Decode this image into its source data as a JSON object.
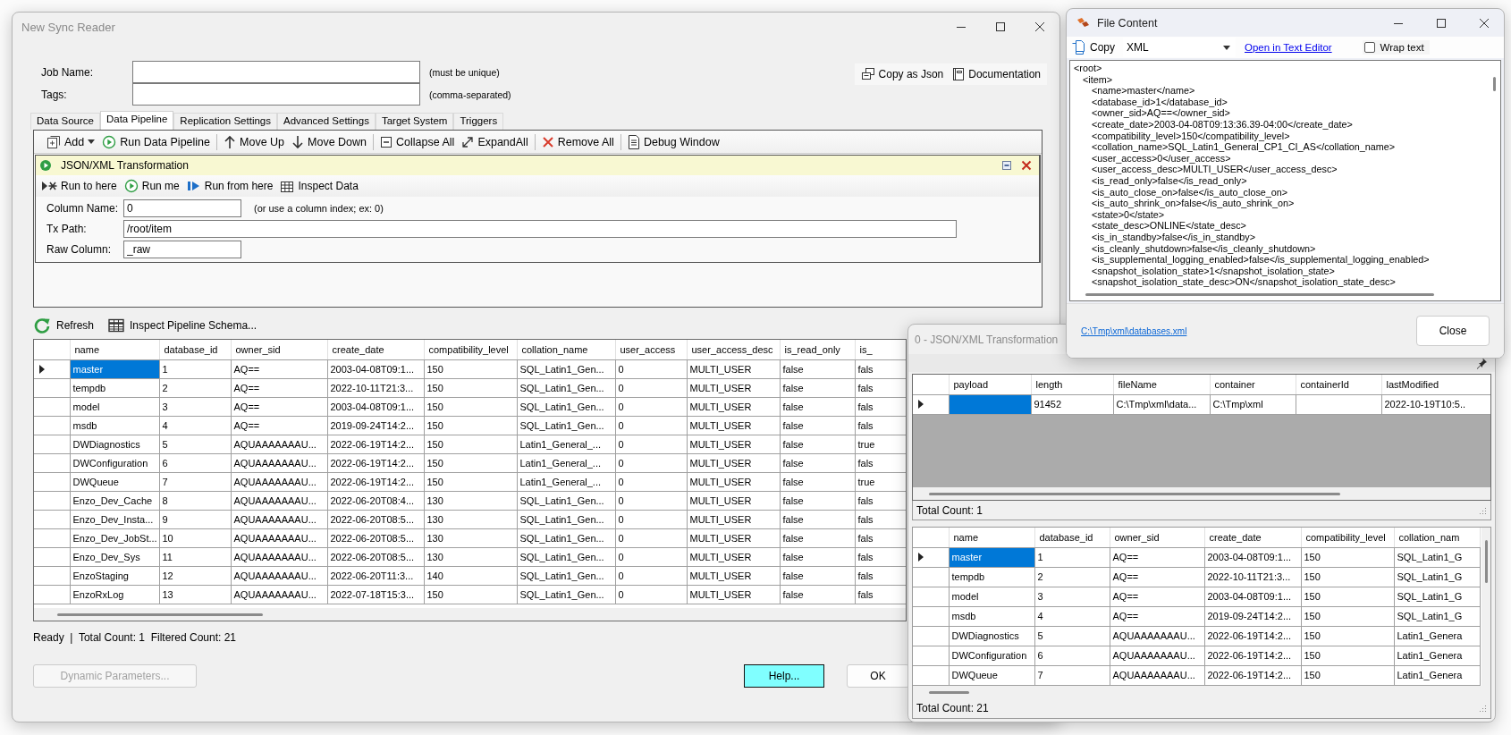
{
  "main_window": {
    "title": "New Sync Reader",
    "fields": [
      {
        "label": "Job Name:",
        "hint": "(must be unique)"
      },
      {
        "label": "Tags:",
        "hint": "(comma-separated)"
      }
    ],
    "header_buttons": [
      "Copy as Json",
      "Documentation"
    ],
    "tabs": [
      {
        "label": "Data Source",
        "selected": false
      },
      {
        "label": "Data Pipeline",
        "selected": true
      },
      {
        "label": "Replication Settings",
        "selected": false
      },
      {
        "label": "Advanced Settings",
        "selected": false
      },
      {
        "label": "Target System",
        "selected": false
      },
      {
        "label": "Triggers",
        "selected": false
      }
    ],
    "toolbar": [
      [
        {
          "label": "Add",
          "kind": "dropdown"
        },
        {
          "label": "Run Data Pipeline",
          "kind": "button"
        }
      ],
      [
        {
          "label": "Move Up",
          "kind": "button"
        },
        {
          "label": "Move Down",
          "kind": "button"
        }
      ],
      [
        {
          "label": "Collapse All",
          "kind": "button"
        },
        {
          "label": "ExpandAll",
          "kind": "button"
        }
      ],
      [
        {
          "label": "Remove All",
          "kind": "button"
        }
      ],
      [
        {
          "label": "Debug Window",
          "kind": "button"
        }
      ]
    ],
    "step": {
      "title": "JSON/XML Transformation",
      "actions": [
        "Run to here",
        "Run me",
        "Run from here",
        "Inspect Data"
      ],
      "fields": [
        {
          "label": "Column Name:",
          "value": "0",
          "hint": "(or use a column index; ex: 0)",
          "kind": "short"
        },
        {
          "label": "Tx Path:",
          "value": "/root/item",
          "kind": "wide"
        },
        {
          "label": "Raw Column:",
          "value": "_raw",
          "kind": "short"
        }
      ]
    },
    "grid_toolbar": [
      "Refresh",
      "Inspect Pipeline Schema..."
    ],
    "grid": {
      "columns": [
        "name",
        "database_id",
        "owner_sid",
        "create_date",
        "compatibility_level",
        "collation_name",
        "user_access",
        "user_access_desc",
        "is_read_only",
        "is_"
      ],
      "rows": [
        {
          "selected": true,
          "cells": [
            "master",
            "1",
            "AQ==",
            "2003-04-08T09:1...",
            "150",
            "SQL_Latin1_Gen...",
            "0",
            "MULTI_USER",
            "false",
            "fals"
          ]
        },
        {
          "selected": false,
          "cells": [
            "tempdb",
            "2",
            "AQ==",
            "2022-10-11T21:3...",
            "150",
            "SQL_Latin1_Gen...",
            "0",
            "MULTI_USER",
            "false",
            "fals"
          ]
        },
        {
          "selected": false,
          "cells": [
            "model",
            "3",
            "AQ==",
            "2003-04-08T09:1...",
            "150",
            "SQL_Latin1_Gen...",
            "0",
            "MULTI_USER",
            "false",
            "fals"
          ]
        },
        {
          "selected": false,
          "cells": [
            "msdb",
            "4",
            "AQ==",
            "2019-09-24T14:2...",
            "150",
            "SQL_Latin1_Gen...",
            "0",
            "MULTI_USER",
            "false",
            "fals"
          ]
        },
        {
          "selected": false,
          "cells": [
            "DWDiagnostics",
            "5",
            "AQUAAAAAAAU...",
            "2022-06-19T14:2...",
            "150",
            "Latin1_General_...",
            "0",
            "MULTI_USER",
            "false",
            "true"
          ]
        },
        {
          "selected": false,
          "cells": [
            "DWConfiguration",
            "6",
            "AQUAAAAAAAU...",
            "2022-06-19T14:2...",
            "150",
            "Latin1_General_...",
            "0",
            "MULTI_USER",
            "false",
            "fals"
          ]
        },
        {
          "selected": false,
          "cells": [
            "DWQueue",
            "7",
            "AQUAAAAAAAU...",
            "2022-06-19T14:2...",
            "150",
            "Latin1_General_...",
            "0",
            "MULTI_USER",
            "false",
            "true"
          ]
        },
        {
          "selected": false,
          "cells": [
            "Enzo_Dev_Cache",
            "8",
            "AQUAAAAAAAU...",
            "2022-06-20T08:4...",
            "130",
            "SQL_Latin1_Gen...",
            "0",
            "MULTI_USER",
            "false",
            "fals"
          ]
        },
        {
          "selected": false,
          "cells": [
            "Enzo_Dev_Insta...",
            "9",
            "AQUAAAAAAAU...",
            "2022-06-20T08:5...",
            "130",
            "SQL_Latin1_Gen...",
            "0",
            "MULTI_USER",
            "false",
            "fals"
          ]
        },
        {
          "selected": false,
          "cells": [
            "Enzo_Dev_JobSt...",
            "10",
            "AQUAAAAAAAU...",
            "2022-06-20T08:5...",
            "130",
            "SQL_Latin1_Gen...",
            "0",
            "MULTI_USER",
            "false",
            "fals"
          ]
        },
        {
          "selected": false,
          "cells": [
            "Enzo_Dev_Sys",
            "11",
            "AQUAAAAAAAU...",
            "2022-06-20T08:5...",
            "130",
            "SQL_Latin1_Gen...",
            "0",
            "MULTI_USER",
            "false",
            "fals"
          ]
        },
        {
          "selected": false,
          "cells": [
            "EnzoStaging",
            "12",
            "AQUAAAAAAAU...",
            "2022-06-20T11:3...",
            "140",
            "SQL_Latin1_Gen...",
            "0",
            "MULTI_USER",
            "false",
            "fals"
          ]
        },
        {
          "selected": false,
          "cells": [
            "EnzoRxLog",
            "13",
            "AQUAAAAAAAU...",
            "2022-07-18T15:3...",
            "150",
            "SQL_Latin1_Gen...",
            "0",
            "MULTI_USER",
            "false",
            "fals"
          ]
        }
      ]
    },
    "status_bar": "Ready  |  Total Count: 1  Filtered Count: 21",
    "buttons": [
      {
        "label": "Dynamic Parameters...",
        "disabled": true,
        "highlighted": false
      },
      {
        "label": "Help...",
        "disabled": false,
        "highlighted": true
      },
      {
        "label": "OK",
        "disabled": false,
        "highlighted": false
      }
    ]
  },
  "transform_window": {
    "title": "0 - JSON/XML Transformation",
    "top_grid": {
      "columns": [
        "payload",
        "length",
        "fileName",
        "container",
        "containerId",
        "lastModified"
      ],
      "rows": [
        {
          "selected": true,
          "cells": [
            null,
            "91452",
            "C:\\Tmp\\xml\\data...",
            "C:\\Tmp\\xml",
            null,
            "2022-10-19T10:5.."
          ]
        }
      ]
    },
    "top_status": "Total Count: 1",
    "bottom_grid": {
      "columns": [
        "name",
        "database_id",
        "owner_sid",
        "create_date",
        "compatibility_level",
        "collation_nam"
      ],
      "rows": [
        {
          "selected": true,
          "cells": [
            "master",
            "1",
            "AQ==",
            "2003-04-08T09:1...",
            "150",
            "SQL_Latin1_G"
          ]
        },
        {
          "selected": false,
          "cells": [
            "tempdb",
            "2",
            "AQ==",
            "2022-10-11T21:3...",
            "150",
            "SQL_Latin1_G"
          ]
        },
        {
          "selected": false,
          "cells": [
            "model",
            "3",
            "AQ==",
            "2003-04-08T09:1...",
            "150",
            "SQL_Latin1_G"
          ]
        },
        {
          "selected": false,
          "cells": [
            "msdb",
            "4",
            "AQ==",
            "2019-09-24T14:2...",
            "150",
            "SQL_Latin1_G"
          ]
        },
        {
          "selected": false,
          "cells": [
            "DWDiagnostics",
            "5",
            "AQUAAAAAAAU...",
            "2022-06-19T14:2...",
            "150",
            "Latin1_Genera"
          ]
        },
        {
          "selected": false,
          "cells": [
            "DWConfiguration",
            "6",
            "AQUAAAAAAAU...",
            "2022-06-19T14:2...",
            "150",
            "Latin1_Genera"
          ]
        },
        {
          "selected": false,
          "cells": [
            "DWQueue",
            "7",
            "AQUAAAAAAAU...",
            "2022-06-19T14:2...",
            "150",
            "Latin1_Genera"
          ]
        }
      ]
    },
    "bottom_status": "Total Count: 21"
  },
  "file_content_window": {
    "title": "File Content",
    "copy": "Copy",
    "format": "XML",
    "open_link": "Open in Text Editor",
    "wrap_text": {
      "label": "Wrap text",
      "checked": false
    },
    "lines": [
      {
        "text": "<root>",
        "children": [
          {
            "text": "<item>",
            "children": [
              {
                "text": "<name>master</name>"
              },
              {
                "text": "<database_id>1</database_id>"
              },
              {
                "text": "<owner_sid>AQ==</owner_sid>"
              },
              {
                "text": "<create_date>2003-04-08T09:13:36.39-04:00</create_date>"
              },
              {
                "text": "<compatibility_level>150</compatibility_level>"
              },
              {
                "text": "<collation_name>SQL_Latin1_General_CP1_CI_AS</collation_name>"
              },
              {
                "text": "<user_access>0</user_access>"
              },
              {
                "text": "<user_access_desc>MULTI_USER</user_access_desc>"
              },
              {
                "text": "<is_read_only>false</is_read_only>"
              },
              {
                "text": "<is_auto_close_on>false</is_auto_close_on>"
              },
              {
                "text": "<is_auto_shrink_on>false</is_auto_shrink_on>"
              },
              {
                "text": "<state>0</state>"
              },
              {
                "text": "<state_desc>ONLINE</state_desc>"
              },
              {
                "text": "<is_in_standby>false</is_in_standby>"
              },
              {
                "text": "<is_cleanly_shutdown>false</is_cleanly_shutdown>"
              },
              {
                "text": "<is_supplemental_logging_enabled>false</is_supplemental_logging_enabled>"
              },
              {
                "text": "<snapshot_isolation_state>1</snapshot_isolation_state>"
              },
              {
                "text": "<snapshot_isolation_state_desc>ON</snapshot_isolation_state_desc>"
              }
            ]
          }
        ]
      }
    ],
    "path_link": "C:\\Tmp\\xml\\databases.xml",
    "close": "Close"
  }
}
